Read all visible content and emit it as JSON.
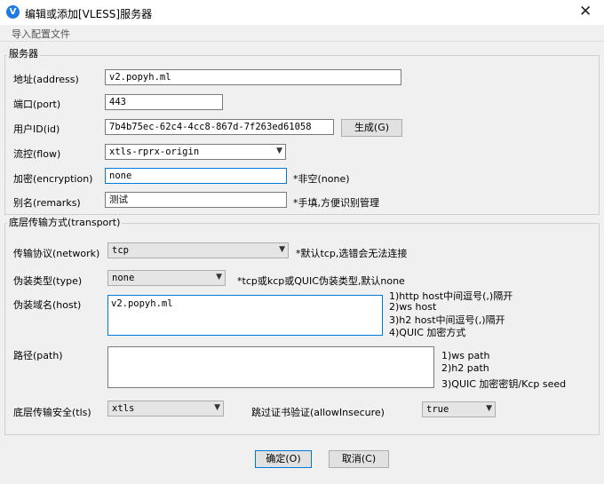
{
  "window": {
    "title": "编辑或添加[VLESS]服务器",
    "close": "✕",
    "app_icon": "V"
  },
  "menu": {
    "import": "导入配置文件"
  },
  "server": {
    "group_label": "服务器",
    "address": {
      "label": "地址(address)",
      "value": "v2.popyh.ml"
    },
    "port": {
      "label": "端口(port)",
      "value": "443"
    },
    "id": {
      "label": "用户ID(id)",
      "value": "7b4b75ec-62c4-4cc8-867d-7f263ed61058",
      "generate_button": "生成(G)"
    },
    "flow": {
      "label": "流控(flow)",
      "value": "xtls-rprx-origin"
    },
    "encryption": {
      "label": "加密(encryption)",
      "value": "none",
      "hint": "*非空(none)"
    },
    "remarks": {
      "label": "别名(remarks)",
      "value": "测试",
      "hint": "*手填,方便识别管理"
    }
  },
  "transport": {
    "group_label": "底层传输方式(transport)",
    "network": {
      "label": "传输协议(network)",
      "value": "tcp",
      "hint": "*默认tcp,选错会无法连接"
    },
    "type": {
      "label": "伪装类型(type)",
      "value": "none",
      "hint": "*tcp或kcp或QUIC伪装类型,默认none"
    },
    "host": {
      "label": "伪装域名(host)",
      "value": "v2.popyh.ml",
      "hints": [
        "1)http host中间逗号(,)隔开",
        "2)ws host",
        "3)h2 host中间逗号(,)隔开",
        "4)QUIC 加密方式"
      ]
    },
    "path": {
      "label": "路径(path)",
      "value": "",
      "hints": [
        "1)ws path",
        "2)h2 path",
        "3)QUIC 加密密钥/Kcp seed"
      ]
    },
    "tls": {
      "label": "底层传输安全(tls)",
      "value": "xtls"
    },
    "allow_insecure": {
      "label": "跳过证书验证(allowInsecure)",
      "value": "true"
    }
  },
  "footer": {
    "ok": "确定(O)",
    "cancel": "取消(C)"
  },
  "colors": {
    "accent": "#0078d7",
    "icon": "#1e7be0"
  }
}
